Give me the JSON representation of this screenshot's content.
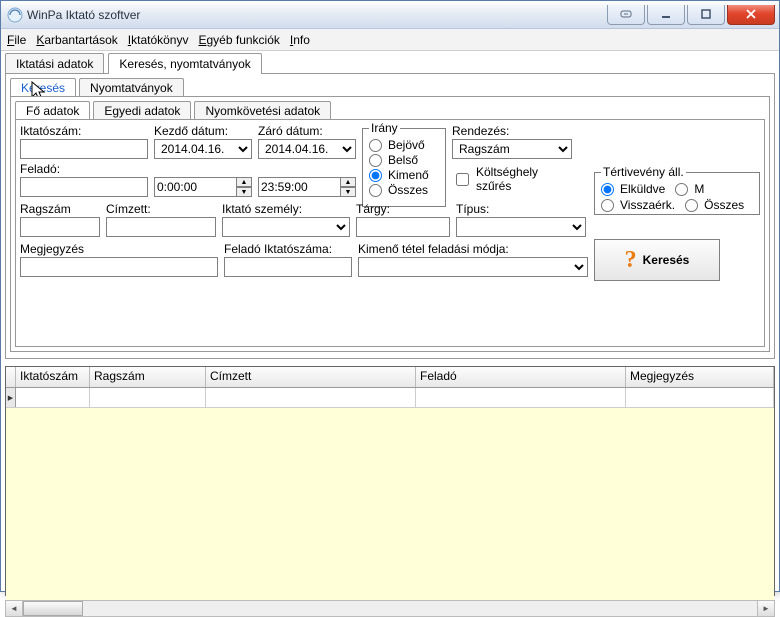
{
  "title": "WinPa Iktató szoftver",
  "menu": {
    "file": "File",
    "karb": "Karbantartások",
    "iktato": "Iktatókönyv",
    "egyeb": "Egyéb funkciók",
    "info": "Info"
  },
  "tabs": {
    "main1": "Iktatási adatok",
    "main2": "Keresés, nyomtatványok",
    "sub1": "Keresés",
    "sub2": "Nyomtatványok",
    "ssub1": "Fő adatok",
    "ssub2": "Egyedi adatok",
    "ssub3": "Nyomkövetési adatok"
  },
  "labels": {
    "iktatoszam": "Iktatószám:",
    "kezdo": "Kezdő dátum:",
    "zaro": "Záró dátum:",
    "felado": "Feladó:",
    "ragszam": "Ragszám",
    "cimzett": "Címzett:",
    "iktatoszemely": "Iktató személy:",
    "targy": "Tárgy:",
    "tipus": "Típus:",
    "megj": "Megjegyzés",
    "feladoikt": "Feladó Iktatószáma:",
    "kimenotetel": "Kimenő tétel feladási módja:",
    "irany": "Irány",
    "rendezes": "Rendezés:",
    "koltsegh": "Költséghely szűrés",
    "tertiv": "Tértivevény áll."
  },
  "values": {
    "kezdo": "2014.04.16.",
    "zaro": "2014.04.16.",
    "time_from": "0:00:00",
    "time_to": "23:59:00",
    "rendezes_sel": "Ragszám"
  },
  "irany": {
    "o1": "Bejövő",
    "o2": "Belső",
    "o3": "Kimenő",
    "o4": "Összes"
  },
  "tertiv": {
    "o1": "Elküldve",
    "o2": "M",
    "o3": "Visszaérk.",
    "o4": "Összes"
  },
  "search_btn": "Keresés",
  "grid": {
    "c1": "Iktatószám",
    "c2": "Ragszám",
    "c3": "Címzett",
    "c4": "Feladó",
    "c5": "Megjegyzés"
  }
}
